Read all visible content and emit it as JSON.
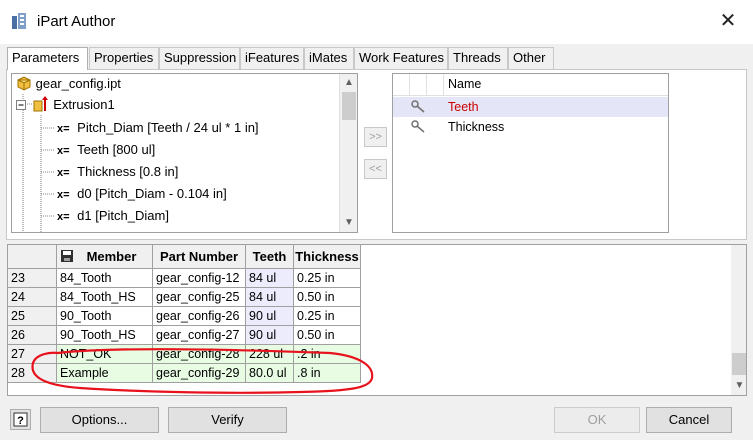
{
  "window": {
    "title": "iPart Author",
    "close_glyph": "✕"
  },
  "tabs": [
    {
      "label": "Parameters",
      "active": true
    },
    {
      "label": "Properties"
    },
    {
      "label": "Suppression"
    },
    {
      "label": "iFeatures"
    },
    {
      "label": "iMates"
    },
    {
      "label": "Work Features"
    },
    {
      "label": "Threads"
    },
    {
      "label": "Other"
    }
  ],
  "tree": {
    "root": "gear_config.ipt",
    "feature": "Extrusion1",
    "prefix": "x=",
    "params": [
      "Pitch_Diam [Teeth / 24 ul * 1 in]",
      "Teeth [800 ul]",
      "Thickness [0.8 in]",
      "d0 [Pitch_Diam - 0.104 in]",
      "d1 [Pitch_Diam]"
    ]
  },
  "move": {
    "add": ">>",
    "remove": "<<"
  },
  "keys": {
    "header": "Name",
    "items": [
      {
        "label": "Teeth",
        "selected": true
      },
      {
        "label": "Thickness",
        "selected": false
      }
    ]
  },
  "table": {
    "headers": [
      "Member",
      "Part Number",
      "Teeth",
      "Thickness"
    ],
    "rows": [
      {
        "n": "23",
        "member": "84_Tooth",
        "part": "gear_config-12",
        "teeth": "84 ul",
        "thickness": "0.25 in"
      },
      {
        "n": "24",
        "member": "84_Tooth_HS",
        "part": "gear_config-25",
        "teeth": "84 ul",
        "thickness": "0.50 in"
      },
      {
        "n": "25",
        "member": "90_Tooth",
        "part": "gear_config-26",
        "teeth": "90 ul",
        "thickness": "0.25 in"
      },
      {
        "n": "26",
        "member": "90_Tooth_HS",
        "part": "gear_config-27",
        "teeth": "90 ul",
        "thickness": "0.50 in"
      },
      {
        "n": "27",
        "member": "NOT_OK",
        "part": "gear_config-28",
        "teeth": "228 ul",
        "thickness": ".2 in"
      },
      {
        "n": "28",
        "member": "Example",
        "part": "gear_config-29",
        "teeth": "80.0 ul",
        "thickness": ".8 in"
      }
    ]
  },
  "buttons": {
    "options": "Options...",
    "verify": "Verify",
    "ok": "OK",
    "cancel": "Cancel"
  },
  "colors": {
    "selected_key_text": "#cc0000",
    "annotation": "#e8121c",
    "teeth_column": "#ececfc",
    "valid_row": "#e8fce4"
  }
}
